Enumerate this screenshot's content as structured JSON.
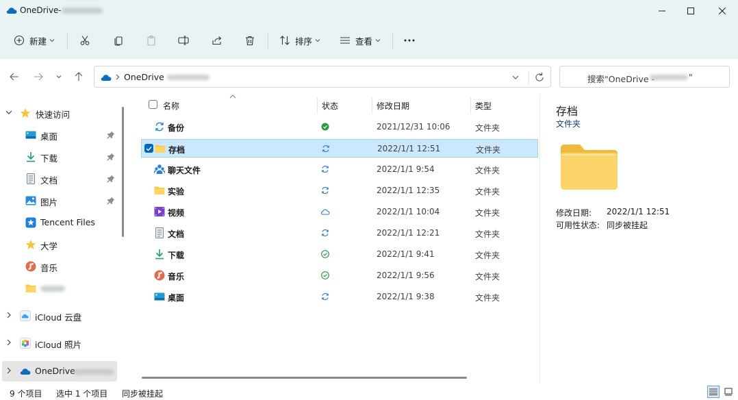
{
  "window": {
    "title": "OneDrive",
    "title_separator": "-",
    "account_name": "f**l.webu.cn"
  },
  "toolbar": {
    "new_label": "新建",
    "sort_label": "排序",
    "view_label": "查看"
  },
  "address": {
    "location": "OneDrive",
    "account_name": "f**l.webu.cn"
  },
  "search": {
    "prefix": "搜索\"OneDrive - ",
    "suffix": "\"",
    "account_name": "f**l.webu.cn"
  },
  "sidebar": {
    "quick_access": "快速访问",
    "items": [
      {
        "label": "桌面",
        "icon": "desktop-icon",
        "pinned": true
      },
      {
        "label": "下载",
        "icon": "download-icon",
        "pinned": true
      },
      {
        "label": "文档",
        "icon": "document-icon",
        "pinned": true
      },
      {
        "label": "图片",
        "icon": "pictures-icon",
        "pinned": true
      },
      {
        "label": "Tencent Files",
        "icon": "tencent-files-icon",
        "pinned": false
      },
      {
        "label": "大学",
        "icon": "star-icon",
        "pinned": false
      },
      {
        "label": "音乐",
        "icon": "music-icon",
        "pinned": false
      },
      {
        "label": "",
        "icon": "folder-icon",
        "pinned": false
      }
    ],
    "icloud_drive": "iCloud 云盘",
    "icloud_photos": "iCloud 照片",
    "onedrive": "OneDrive",
    "onedrive_account": "f**l.webu.cn"
  },
  "columns": {
    "name": "名称",
    "status": "状态",
    "modified": "修改日期",
    "type": "类型"
  },
  "files": [
    {
      "name": "备份",
      "icon": "backup-icon",
      "status": "synced-filled",
      "modified": "2021/12/31 10:06",
      "type": "文件夹",
      "selected": false
    },
    {
      "name": "存档",
      "icon": "folder-icon",
      "status": "sync-pending",
      "modified": "2022/1/1 12:51",
      "type": "文件夹",
      "selected": true
    },
    {
      "name": "聊天文件",
      "icon": "chat-files-icon",
      "status": "sync-pending",
      "modified": "2022/1/1 9:54",
      "type": "文件夹",
      "selected": false
    },
    {
      "name": "实验",
      "icon": "folder-icon",
      "status": "sync-pending",
      "modified": "2022/1/1 12:35",
      "type": "文件夹",
      "selected": false
    },
    {
      "name": "视频",
      "icon": "video-icon",
      "status": "cloud-only",
      "modified": "2022/1/1 10:04",
      "type": "文件夹",
      "selected": false
    },
    {
      "name": "文档",
      "icon": "document-icon",
      "status": "sync-pending",
      "modified": "2022/1/1 12:21",
      "type": "文件夹",
      "selected": false
    },
    {
      "name": "下载",
      "icon": "download-icon",
      "status": "synced-outline",
      "modified": "2022/1/1 9:41",
      "type": "文件夹",
      "selected": false
    },
    {
      "name": "音乐",
      "icon": "music-icon",
      "status": "synced-outline",
      "modified": "2022/1/1 9:56",
      "type": "文件夹",
      "selected": false
    },
    {
      "name": "桌面",
      "icon": "desktop-icon",
      "status": "sync-pending",
      "modified": "2022/1/1 9:38",
      "type": "文件夹",
      "selected": false
    }
  ],
  "details": {
    "name": "存档",
    "type": "文件夹",
    "modified_label": "修改日期:",
    "modified_value": "2022/1/1 12:51",
    "availability_label": "可用性状态:",
    "availability_value": "同步被挂起"
  },
  "status_bar": {
    "item_count": "9 个项目",
    "selection": "选中 1 个项目",
    "sync_state": "同步被挂起"
  },
  "colors": {
    "accent": "#0067c0",
    "selection_bg": "#cce8ff",
    "synced_green": "#2b9a44",
    "sync_blue": "#2b7fd4",
    "folder_yellow": "#f7c948"
  }
}
